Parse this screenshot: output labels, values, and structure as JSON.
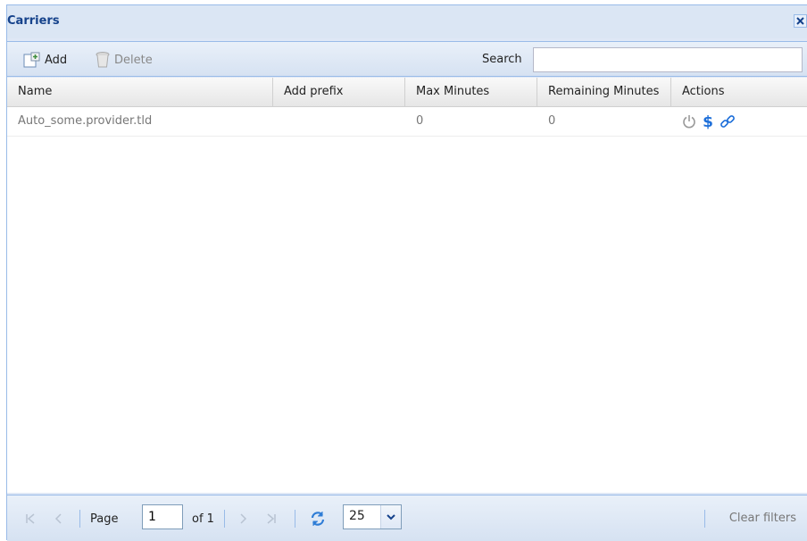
{
  "window": {
    "title": "Carriers"
  },
  "toolbar": {
    "add_label": "Add",
    "delete_label": "Delete",
    "search_label": "Search",
    "search_value": ""
  },
  "grid": {
    "columns": [
      "Name",
      "Add prefix",
      "Max Minutes",
      "Remaining Minutes",
      "Actions"
    ],
    "rows": [
      {
        "name": "Auto_some.provider.tld",
        "add_prefix": "",
        "max_minutes": "0",
        "remaining_minutes": "0",
        "actions": [
          "power-icon",
          "dollar-icon",
          "link-icon"
        ]
      }
    ]
  },
  "pager": {
    "page_label": "Page",
    "page_value": "1",
    "of_label": "of 1",
    "page_size": "25",
    "clear_filters_label": "Clear filters"
  },
  "colors": {
    "title": "#15428b",
    "border": "#99bbe8",
    "action_blue": "#1e6fd9",
    "power_gray": "#999999"
  }
}
